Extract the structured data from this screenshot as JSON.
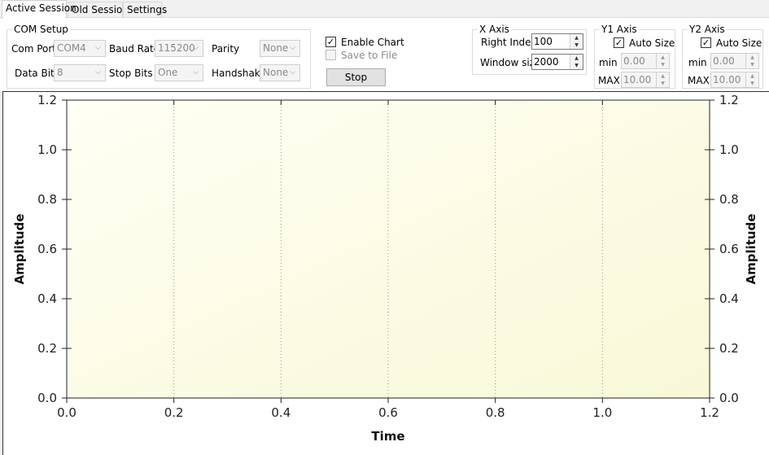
{
  "tabs": [
    {
      "label": "Active Session",
      "active": true
    },
    {
      "label": "Old Session",
      "active": false
    },
    {
      "label": "Settings",
      "active": false
    }
  ],
  "com_setup": {
    "title": "COM Setup",
    "com_port": {
      "label": "Com Port",
      "value": "COM4"
    },
    "baud_rate": {
      "label": "Baud Rate",
      "value": "115200"
    },
    "parity": {
      "label": "Parity",
      "value": "None"
    },
    "data_bits": {
      "label": "Data Bits",
      "value": "8"
    },
    "stop_bits": {
      "label": "Stop Bits",
      "value": "One"
    },
    "handshake": {
      "label": "Handshake",
      "value": "None"
    }
  },
  "controls": {
    "enable_chart": {
      "label": "Enable Chart",
      "checked": true
    },
    "save_to_file": {
      "label": "Save to File",
      "checked": false
    },
    "stop_button": "Stop"
  },
  "x_axis": {
    "title": "X Axis",
    "right_indent": {
      "label": "Right Indent",
      "value": "100"
    },
    "window_size": {
      "label": "Window size",
      "value": "2000"
    }
  },
  "y1_axis": {
    "title": "Y1 Axis",
    "auto_size": {
      "label": "Auto Size",
      "checked": true
    },
    "min": {
      "label": "min",
      "value": "0.00"
    },
    "max": {
      "label": "MAX",
      "value": "10.00"
    }
  },
  "y2_axis": {
    "title": "Y2 Axis",
    "auto_size": {
      "label": "Auto Size",
      "checked": true
    },
    "min": {
      "label": "min",
      "value": "0.00"
    },
    "max": {
      "label": "MAX",
      "value": "10.00"
    }
  },
  "chart_data": {
    "type": "line",
    "title": "",
    "xlabel": "Time",
    "ylabel": "Amplitude",
    "y2label": "Amplitude",
    "xlim": [
      0.0,
      1.2
    ],
    "ylim": [
      0.0,
      1.2
    ],
    "x_ticks": [
      "0.0",
      "0.2",
      "0.4",
      "0.6",
      "0.8",
      "1.0",
      "1.2"
    ],
    "y_ticks": [
      "0.0",
      "0.2",
      "0.4",
      "0.6",
      "0.8",
      "1.0",
      "1.2"
    ],
    "series": [],
    "vertical_grid": true,
    "horizontal_grid": false,
    "plot_background": [
      "#fffff4",
      "#f8f8d8"
    ]
  }
}
